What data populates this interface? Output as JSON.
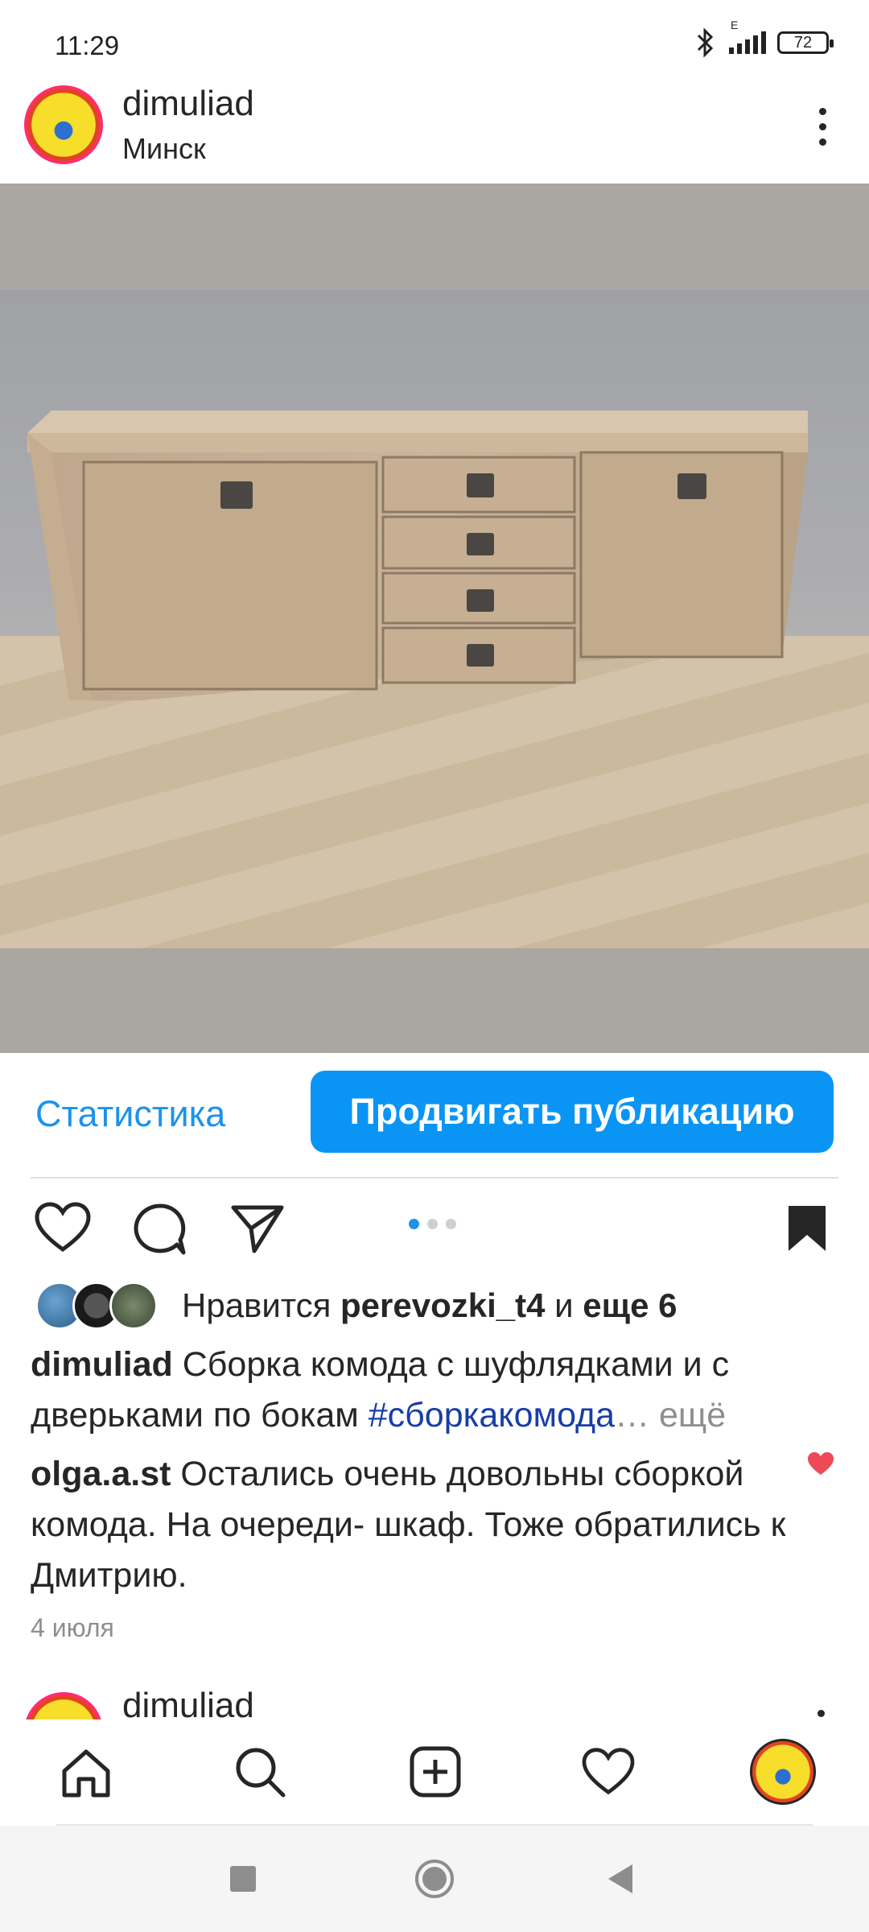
{
  "status_bar": {
    "time": "11:29",
    "network": "E",
    "battery": "72",
    "icons": [
      "bluetooth-icon",
      "signal-icon",
      "battery-icon"
    ]
  },
  "header": {
    "username": "dimuliad",
    "location": "Минск"
  },
  "actions": {
    "statistics": "Статистика",
    "promote": "Продвигать публикацию"
  },
  "carousel": {
    "count": 3,
    "active": 1
  },
  "likes": {
    "prefix": "Нравится",
    "user": "perevozki_t4",
    "joiner": "и",
    "others": "еще 6"
  },
  "caption": {
    "username": "dimuliad",
    "text": "Сборка комода с шуфлядками и с дверьками по бокам",
    "hashtag": "#сборкакомода",
    "ellipsis": "…",
    "more": "ещё"
  },
  "comment": {
    "username": "olga.a.st",
    "text": "Остались очень довольны сборкой комода. На очереди- шкаф. Тоже обратились к Дмитрию."
  },
  "date": "4 июля",
  "next_post": {
    "username": "dimuliad"
  },
  "colors": {
    "accent": "#0a95f5",
    "link": "#1d93ea",
    "hashtag": "#173ea8",
    "like": "#ed4956"
  }
}
